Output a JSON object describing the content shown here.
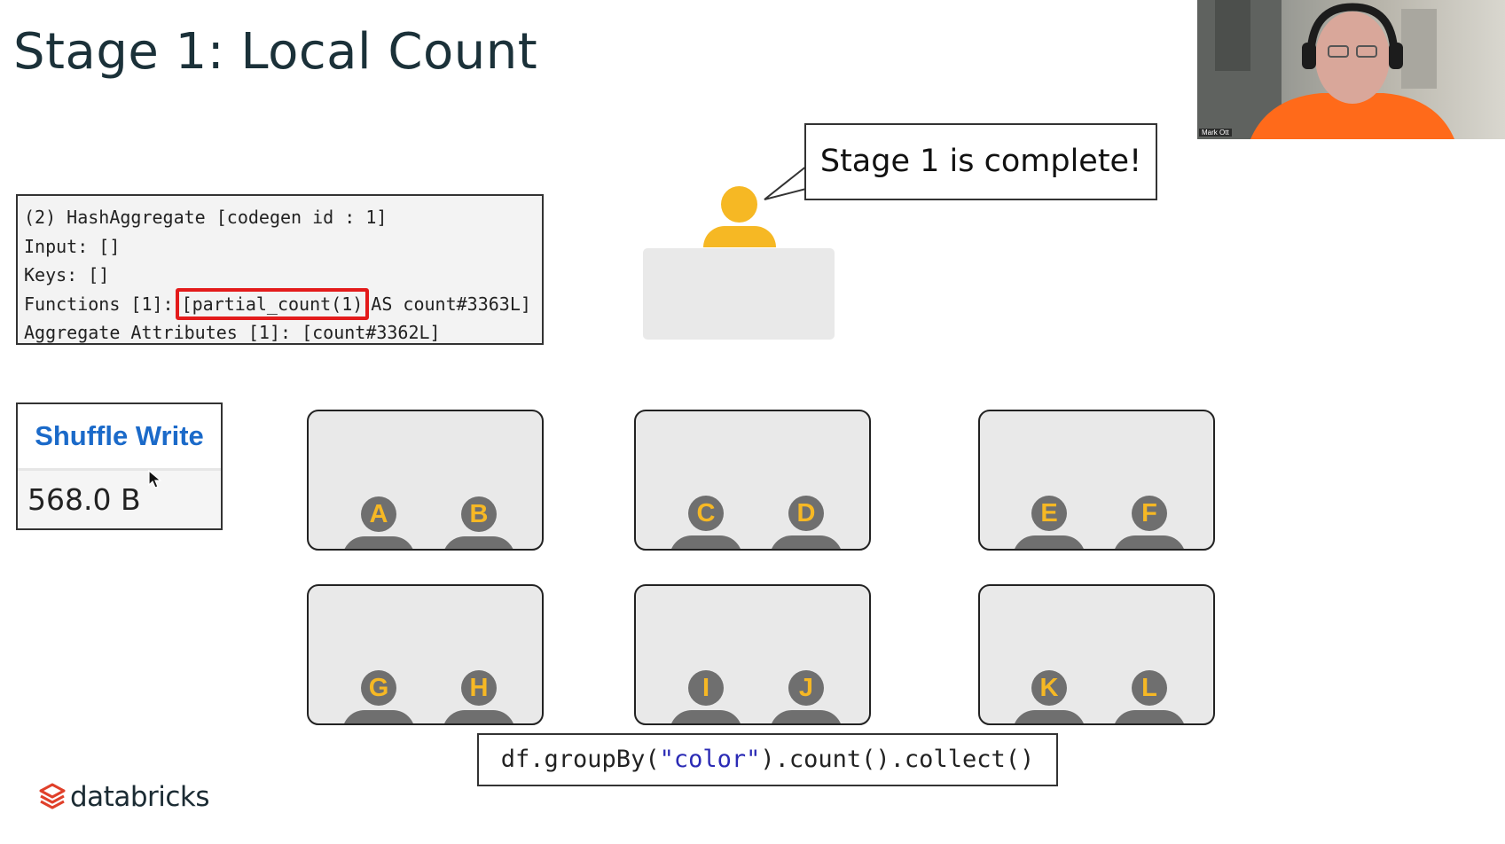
{
  "slide": {
    "title": "Stage 1: Local Count"
  },
  "plan_details": {
    "line1": "(2) HashAggregate [codegen id : 1]",
    "line2": "Input: []",
    "line3": "Keys: []",
    "line4_prefix": "Functions [1]:",
    "line4_highlight": "[partial_count(1)",
    "line4_suffix": "AS count#3363L]",
    "line5": "Aggregate Attributes [1]: [count#3362L]"
  },
  "shuffle": {
    "heading": "Shuffle Write",
    "value": "568.0 B"
  },
  "driver": {
    "speech": "Stage 1 is complete!"
  },
  "executors": [
    {
      "slots": [
        "A",
        "B"
      ]
    },
    {
      "slots": [
        "C",
        "D"
      ]
    },
    {
      "slots": [
        "E",
        "F"
      ]
    },
    {
      "slots": [
        "G",
        "H"
      ]
    },
    {
      "slots": [
        "I",
        "J"
      ]
    },
    {
      "slots": [
        "K",
        "L"
      ]
    }
  ],
  "command": {
    "part1": "df.groupBy(",
    "string": "\"color\"",
    "part2": ").count().collect()"
  },
  "logo": {
    "text": "databricks"
  },
  "webcam": {
    "name": "Mark Ott"
  },
  "colors": {
    "title": "#1b3139",
    "highlight_border": "#e31b1b",
    "shuffle_heading": "#1b6ac9",
    "person_accent": "#f6b824",
    "person_gray": "#6f6f6f",
    "logo_red": "#e0402a"
  }
}
